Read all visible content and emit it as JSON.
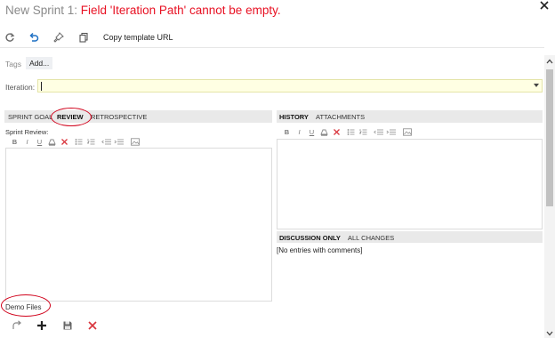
{
  "title": {
    "prefix": "New Sprint 1: ",
    "error": "Field 'Iteration Path' cannot be empty."
  },
  "toolbar": {
    "icons": [
      "refresh-icon",
      "undo-icon",
      "pin-icon",
      "copy-icon"
    ],
    "copy_template_url": "Copy template URL"
  },
  "tags": {
    "label": "Tags",
    "add": "Add..."
  },
  "iteration": {
    "label": "Iteration:",
    "value": ""
  },
  "left_pane": {
    "tabs": [
      "SPRINT GOAL",
      "REVIEW",
      "RETROSPECTIVE"
    ],
    "active_tab": "REVIEW",
    "field_label": "Sprint Review:"
  },
  "right_pane": {
    "tabs": [
      "HISTORY",
      "ATTACHMENTS"
    ],
    "active_tab": "HISTORY",
    "discussion_tabs": [
      "DISCUSSION ONLY",
      "ALL CHANGES"
    ],
    "discussion_active": "DISCUSSION ONLY",
    "empty_message": "[No entries with comments]"
  },
  "rte_buttons": [
    "B",
    "I",
    "U",
    "highlight",
    "clear",
    "bullets",
    "numbering",
    "outdent",
    "indent",
    "image"
  ],
  "attachments": {
    "label": "Demo Files",
    "icons": [
      "open-icon",
      "add-icon",
      "save-icon",
      "delete-icon"
    ]
  },
  "colors": {
    "error": "#e81123",
    "annotation": "#d0021b",
    "required_field": "#ffffe3",
    "tab_strip": "#e9e9e9"
  }
}
